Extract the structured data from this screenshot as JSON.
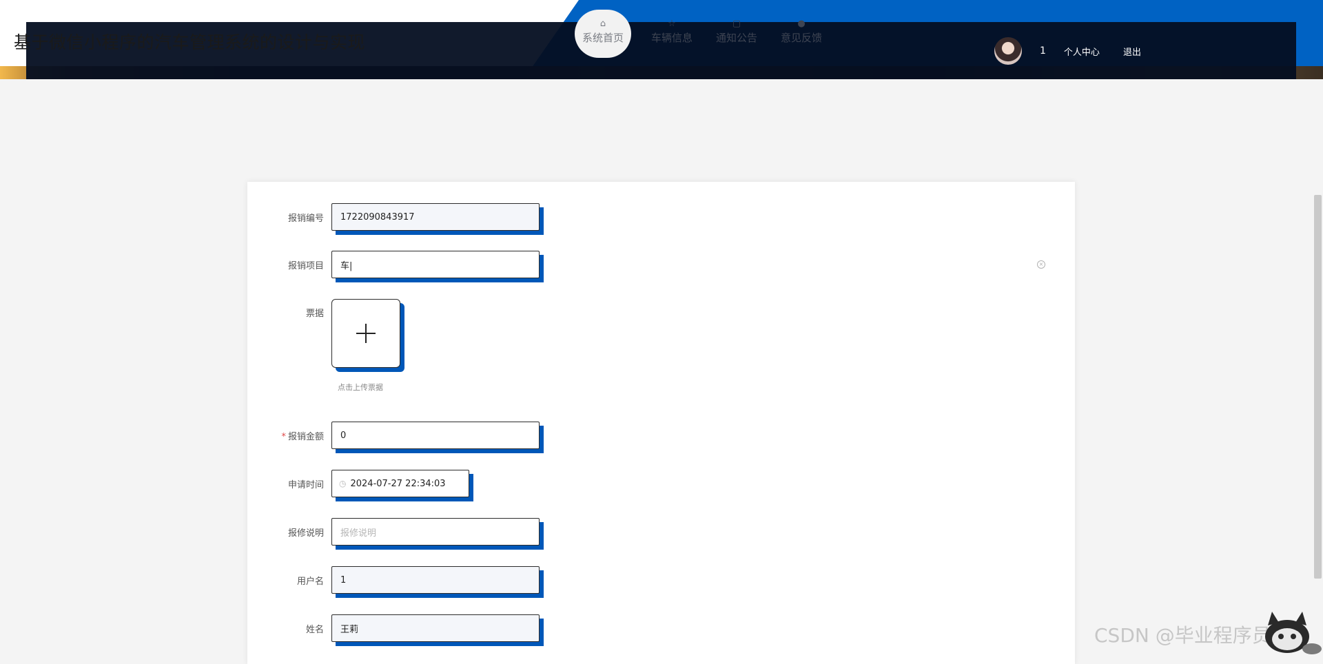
{
  "header": {
    "site_title": "基于微信小程序的汽车管理系统的设计与实现",
    "nav": [
      {
        "label": "系统首页",
        "icon": "home-icon",
        "active": true
      },
      {
        "label": "车辆信息",
        "icon": "star-icon",
        "active": false
      },
      {
        "label": "通知公告",
        "icon": "bag-icon",
        "active": false
      },
      {
        "label": "意见反馈",
        "icon": "info-icon",
        "active": false
      }
    ],
    "user": {
      "name": "1",
      "profile_label": "个人中心",
      "logout_label": "退出"
    }
  },
  "form": {
    "reimburse_no": {
      "label": "报销编号",
      "value": "1722090843917"
    },
    "reimburse_item": {
      "label": "报销项目",
      "value": "车|"
    },
    "receipt": {
      "label": "票据",
      "hint": "点击上传票据"
    },
    "amount": {
      "label": "报销金额",
      "required_mark": "*",
      "value": "0"
    },
    "apply_time": {
      "label": "申请时间",
      "value": "2024-07-27 22:34:03"
    },
    "repair_desc": {
      "label": "报修说明",
      "placeholder": "报修说明"
    },
    "username": {
      "label": "用户名",
      "value": "1"
    },
    "real_name": {
      "label": "姓名",
      "value": "王莉"
    }
  },
  "watermark": {
    "text": "CSDN @毕业程序员"
  },
  "colors": {
    "accent_blue": "#0062c3",
    "header_dark": "#040e21",
    "required_red": "#e04a4a",
    "page_bg": "#f4f4f4"
  }
}
